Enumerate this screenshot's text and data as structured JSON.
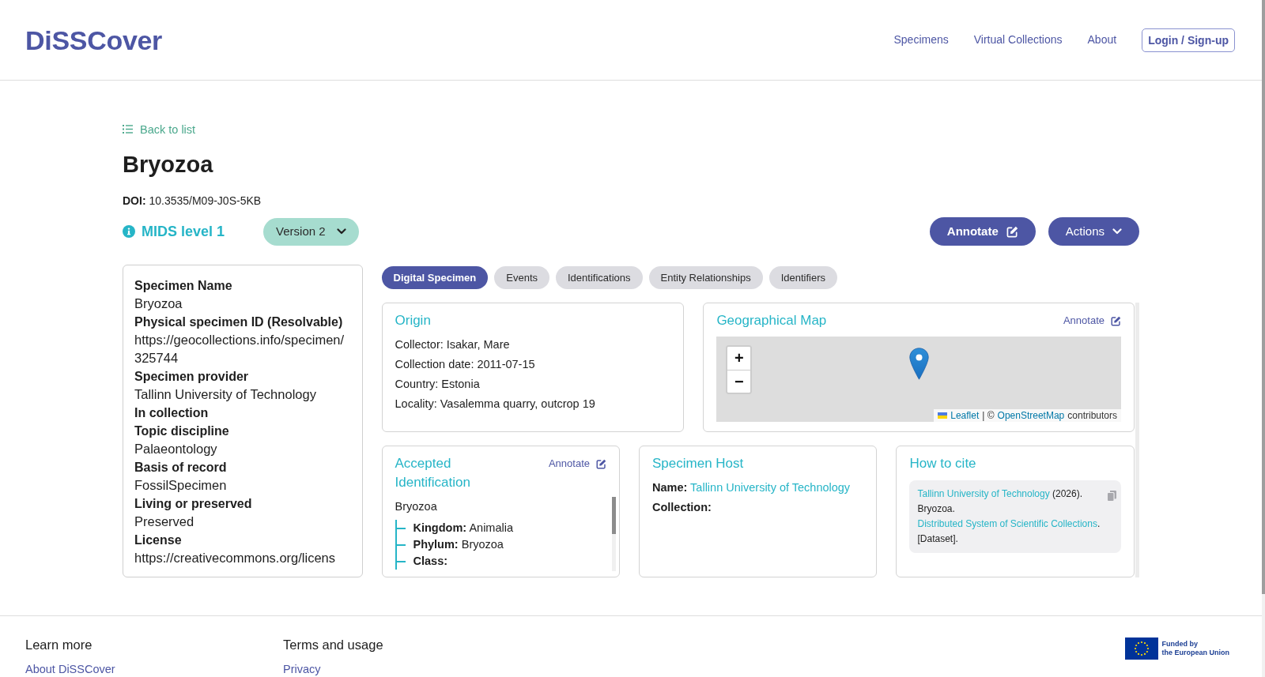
{
  "header": {
    "logo": "DiSSCover",
    "nav": [
      {
        "label": "Specimens"
      },
      {
        "label": "Virtual Collections"
      },
      {
        "label": "About"
      }
    ],
    "login_button": "Login / Sign-up"
  },
  "back_link": "Back to list",
  "title": "Bryozoa",
  "doi": {
    "label": "DOI:",
    "value": "10.3535/M09-J0S-5KB"
  },
  "mids_level": "MIDS level 1",
  "version_dropdown": "Version 2",
  "buttons": [
    {
      "kind": "annotate",
      "label": "Annotate"
    },
    {
      "kind": "dropdown",
      "label": "Actions"
    }
  ],
  "summary": [
    {
      "label": "Specimen Name",
      "value": "Bryozoa"
    },
    {
      "label": "Physical specimen ID (Resolvable)",
      "value": "https://geocollections.info/specimen/325744"
    },
    {
      "label": "Specimen provider",
      "value": "Tallinn University of Technology"
    },
    {
      "label": "In collection"
    },
    {
      "label": "Topic discipline",
      "value": "Palaeontology"
    },
    {
      "label": "Basis of record",
      "value": "FossilSpecimen"
    },
    {
      "label": "Living or preserved",
      "value": "Preserved"
    },
    {
      "label": "License",
      "value": "https://creativecommons.org/licens"
    }
  ],
  "tabs": [
    {
      "label": "Digital Specimen",
      "selected": true
    },
    {
      "label": "Events",
      "selected": false
    },
    {
      "label": "Identifications",
      "selected": false
    },
    {
      "label": "Entity Relationships",
      "selected": false
    },
    {
      "label": "Identifiers",
      "selected": false
    }
  ],
  "origin": {
    "title": "Origin",
    "fields": [
      {
        "label": "Collector:",
        "value": "Isakar, Mare"
      },
      {
        "label": "Collection date:",
        "value": "2011-07-15"
      },
      {
        "label": "Country:",
        "value": "Estonia"
      },
      {
        "label": "Locality:",
        "value": "Vasalemma quarry, outcrop 19"
      }
    ]
  },
  "map": {
    "title": "Geographical Map",
    "annotate": "Annotate",
    "zoom_in": "+",
    "zoom_out": "−",
    "attribution": [
      {
        "kind": "link",
        "text": "Leaflet"
      },
      {
        "kind": "text",
        "text": "| ©"
      },
      {
        "kind": "link",
        "text": "OpenStreetMap"
      },
      {
        "kind": "text",
        "text": "contributors"
      }
    ]
  },
  "accepted_identification": {
    "title": "Accepted Identification",
    "annotate": "Annotate",
    "name": "Bryozoa",
    "ranks": [
      {
        "label": "Kingdom:",
        "value": "Animalia"
      },
      {
        "label": "Phylum:",
        "value": "Bryozoa"
      },
      {
        "label": "Class:"
      }
    ]
  },
  "specimen_host": {
    "title": "Specimen Host",
    "fields": [
      {
        "label": "Name:",
        "value": "Tallinn University of Technology"
      },
      {
        "label": "Collection:"
      }
    ]
  },
  "citation": {
    "title": "How to cite",
    "parts": [
      {
        "kind": "link",
        "text": "Tallinn University of Technology"
      },
      {
        "kind": "text",
        "text": " (2026). Bryozoa. "
      },
      {
        "kind": "link",
        "text": "Distributed System of Scientific Collections"
      },
      {
        "kind": "text",
        "text": ". [Dataset]."
      }
    ]
  },
  "footer": {
    "columns": [
      {
        "heading": "Learn more",
        "links": [
          "About DiSSCover"
        ]
      },
      {
        "heading": "Terms and usage",
        "links": [
          "Privacy"
        ]
      }
    ],
    "funding": [
      "Funded by",
      "the European Union"
    ]
  }
}
